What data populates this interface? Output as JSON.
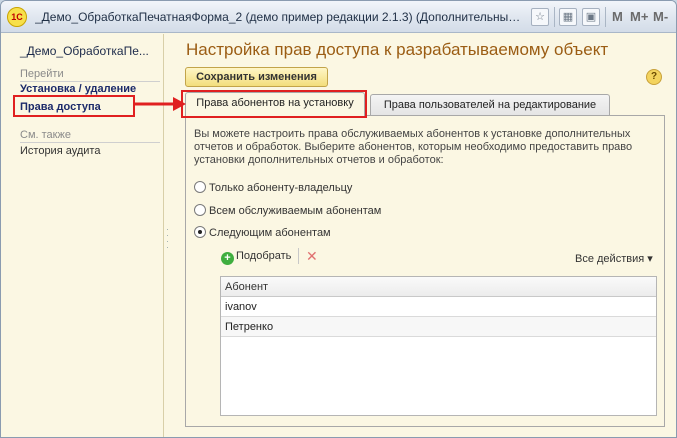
{
  "window": {
    "title": "_Демо_ОбработкаПечатнаяФорма_2 (демо пример редакции 2.1.3) (Дополнительный отчет и...",
    "logo": "1С",
    "toolbar": {
      "m": "M",
      "m_plus": "M+",
      "m_minus": "M-"
    }
  },
  "sidebar": {
    "title": "_Демо_ОбработкаПе...",
    "go_heading": "Перейти",
    "items": [
      {
        "label": "Установка / удаление"
      },
      {
        "label": "Права доступа"
      }
    ],
    "see_also_heading": "См. также",
    "see_also_items": [
      {
        "label": "История аудита"
      }
    ]
  },
  "main": {
    "title": "Настройка прав доступа к разрабатываемому объект",
    "save_label": "Сохранить изменения",
    "help": "?",
    "tabs": [
      {
        "label": "Права абонентов на установку"
      },
      {
        "label": "Права пользователей на редактирование"
      }
    ],
    "description": "Вы можете настроить права обслуживаемых абонентов к установке дополнительных отчетов и обработок. Выберите абонентов, которым необходимо предоставить право установки дополнительных отчетов и обработок:",
    "options": [
      {
        "label": "Только абоненту-владельцу",
        "checked": false
      },
      {
        "label": "Всем обслуживаемым абонентам",
        "checked": false
      },
      {
        "label": "Следующим абонентам",
        "checked": true
      }
    ],
    "pick_label": "Подобрать",
    "all_actions_label": "Все действия ▾",
    "grid": {
      "header": "Абонент",
      "rows": [
        "ivanov",
        "Петренко"
      ]
    }
  },
  "colors": {
    "highlight": "#e02020",
    "title": "#9b5d14",
    "panel_bg": "#fbf7e3"
  }
}
